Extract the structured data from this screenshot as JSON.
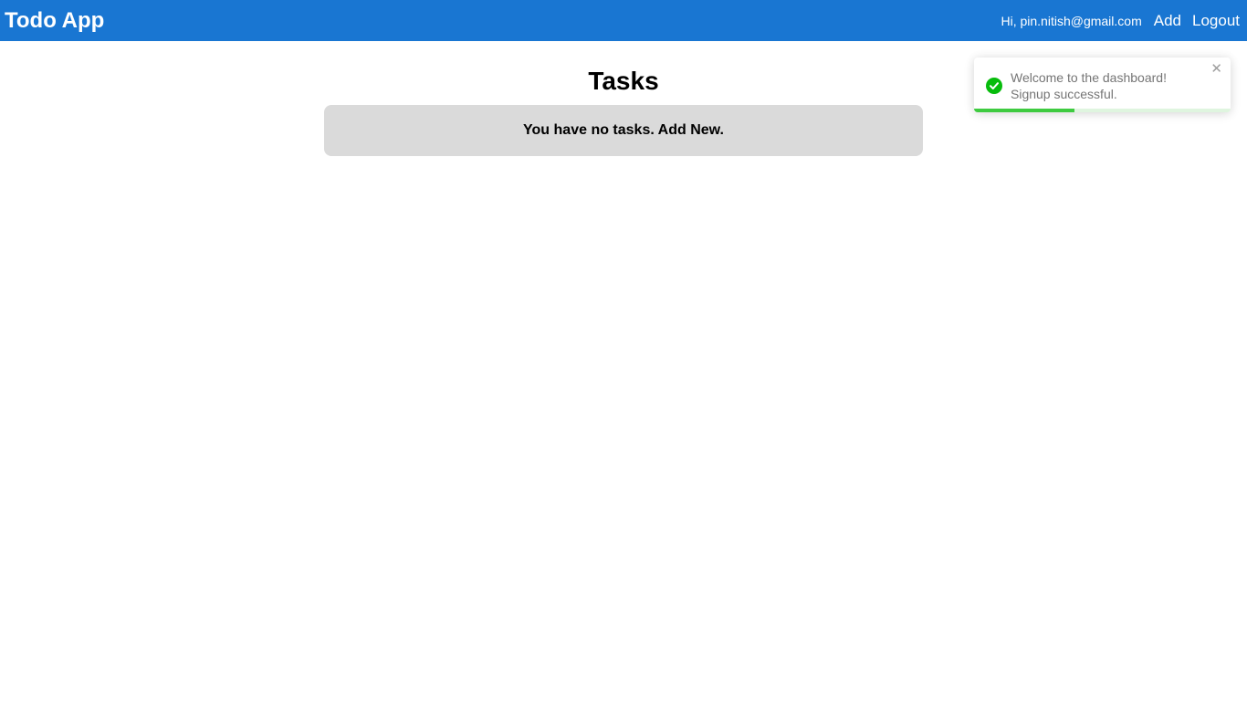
{
  "navbar": {
    "brand": "Todo App",
    "greeting": "Hi, pin.nitish@gmail.com",
    "add_label": "Add",
    "logout_label": "Logout"
  },
  "main": {
    "title": "Tasks",
    "empty_message": "You have no tasks. Add New."
  },
  "toast": {
    "line1": "Welcome to the dashboard!",
    "line2": "Signup successful.",
    "close_glyph": "✕",
    "icon": "check-circle-icon",
    "progress": 0.39
  },
  "colors": {
    "navbar_bg": "#1976d2",
    "empty_box_bg": "#dadada",
    "success": "#07bc0c",
    "progress": "#3ecb40"
  }
}
